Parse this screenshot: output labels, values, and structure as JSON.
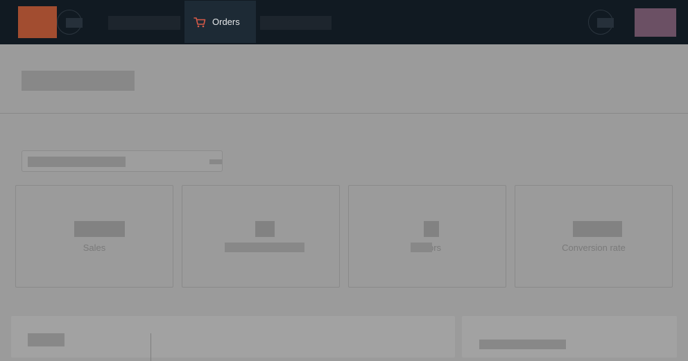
{
  "colors": {
    "topbar": "#111a22",
    "logo": "#a24d30",
    "avatar": "#6b5064",
    "accent": "#d95a48",
    "overlay": "#9b9b9b"
  },
  "nav": {
    "active_item": {
      "label": "Orders",
      "icon": "shopping-cart-icon"
    }
  },
  "metrics": [
    {
      "label": "Sales"
    },
    {
      "label": ""
    },
    {
      "label": "ors"
    },
    {
      "label": "Conversion rate"
    }
  ]
}
